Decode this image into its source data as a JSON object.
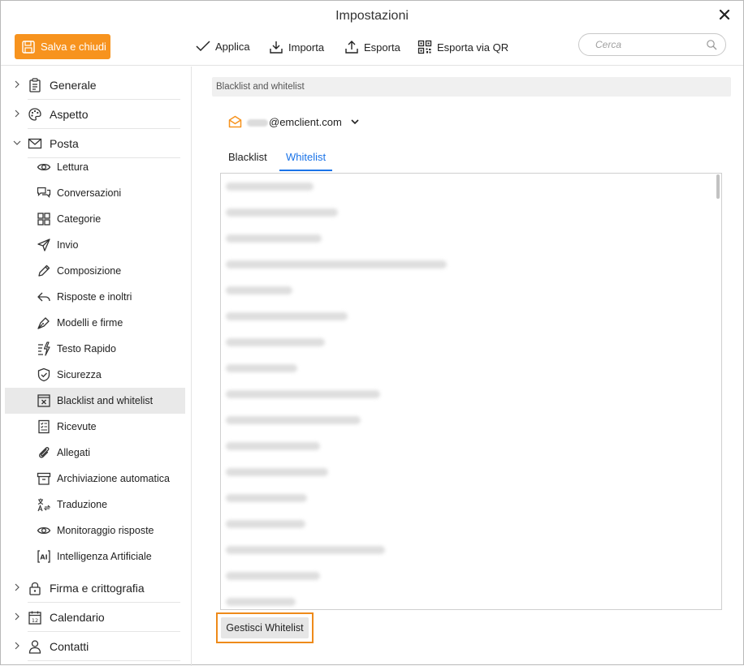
{
  "window": {
    "title": "Impostazioni"
  },
  "toolbar": {
    "save_label": "Salva e chiudi",
    "apply_label": "Applica",
    "import_label": "Importa",
    "export_label": "Esporta",
    "export_qr_label": "Esporta via QR",
    "search_placeholder": "Cerca"
  },
  "colors": {
    "accent": "#f7931e",
    "link": "#1a73e8",
    "highlight": "#ee8a1a"
  },
  "sidebar": {
    "sections": [
      {
        "label": "Generale",
        "icon": "clipboard-icon"
      },
      {
        "label": "Aspetto",
        "icon": "palette-icon"
      },
      {
        "label": "Posta",
        "icon": "envelope-icon",
        "expanded": true
      },
      {
        "label": "Firma e crittografia",
        "icon": "lock-icon"
      },
      {
        "label": "Calendario",
        "icon": "calendar-icon"
      },
      {
        "label": "Contatti",
        "icon": "person-icon"
      }
    ],
    "mail_items": [
      {
        "label": "Lettura",
        "icon": "eye-icon"
      },
      {
        "label": "Conversazioni",
        "icon": "chat-icon"
      },
      {
        "label": "Categorie",
        "icon": "grid-icon"
      },
      {
        "label": "Invio",
        "icon": "send-icon"
      },
      {
        "label": "Composizione",
        "icon": "pencil-icon"
      },
      {
        "label": "Risposte e inoltri",
        "icon": "reply-icon"
      },
      {
        "label": "Modelli e firme",
        "icon": "pen-nib-icon"
      },
      {
        "label": "Testo Rapido",
        "icon": "quick-text-icon"
      },
      {
        "label": "Sicurezza",
        "icon": "shield-icon"
      },
      {
        "label": "Blacklist and whitelist",
        "icon": "blocked-icon",
        "active": true
      },
      {
        "label": "Ricevute",
        "icon": "receipt-icon"
      },
      {
        "label": "Allegati",
        "icon": "paperclip-icon"
      },
      {
        "label": "Archiviazione automatica",
        "icon": "archive-icon"
      },
      {
        "label": "Traduzione",
        "icon": "translate-icon"
      },
      {
        "label": "Monitoraggio risposte",
        "icon": "eye-icon"
      },
      {
        "label": "Intelligenza Artificiale",
        "icon": "ai-icon"
      }
    ]
  },
  "main": {
    "section_title": "Blacklist and whitelist",
    "account": {
      "email_domain": "@emclient.com"
    },
    "tabs": [
      {
        "label": "Blacklist",
        "active": false
      },
      {
        "label": "Whitelist",
        "active": true
      }
    ],
    "manage_button": "Gestisci Whitelist"
  }
}
